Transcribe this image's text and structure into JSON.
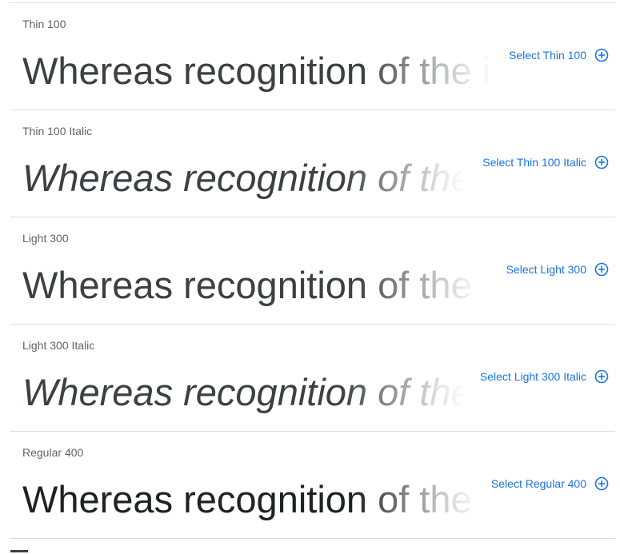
{
  "sample_sentence": "Whereas recognition of the inherent dignity",
  "styles": [
    {
      "name": "Thin 100",
      "select_label": "Select Thin 100",
      "weight": 100,
      "italic": false
    },
    {
      "name": "Thin 100 Italic",
      "select_label": "Select Thin 100 Italic",
      "weight": 100,
      "italic": true
    },
    {
      "name": "Light 300",
      "select_label": "Select Light 300",
      "weight": 300,
      "italic": false
    },
    {
      "name": "Light 300 Italic",
      "select_label": "Select Light 300 Italic",
      "weight": 300,
      "italic": true
    },
    {
      "name": "Regular 400",
      "select_label": "Select Regular 400",
      "weight": 400,
      "italic": false
    }
  ],
  "colors": {
    "accent": "#1a73e8",
    "label": "#5f6368",
    "divider": "#dadce0",
    "text": "#202124"
  },
  "icons": {
    "select": "plus-circle-icon"
  }
}
